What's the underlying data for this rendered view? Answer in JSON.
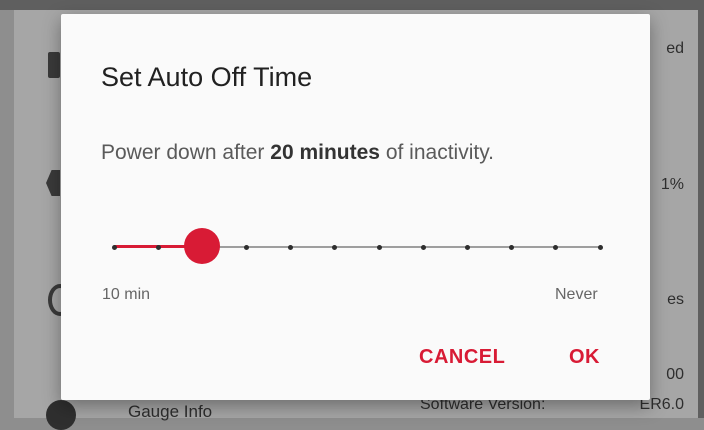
{
  "background": {
    "item_label": "Gauge Info",
    "item_sub": "Software Version:",
    "right_values": [
      "ed",
      "1%",
      "es",
      "00",
      "ER6.0"
    ]
  },
  "dialog": {
    "title": "Set Auto Off Time",
    "message_prefix": "Power down after ",
    "message_value": "20 minutes",
    "message_suffix": " of inactivity.",
    "slider": {
      "min_label": "10 min",
      "max_label": "Never",
      "steps": 12,
      "selected_index": 2,
      "accent_color": "#d81b35"
    },
    "cancel_label": "CANCEL",
    "ok_label": "OK"
  }
}
